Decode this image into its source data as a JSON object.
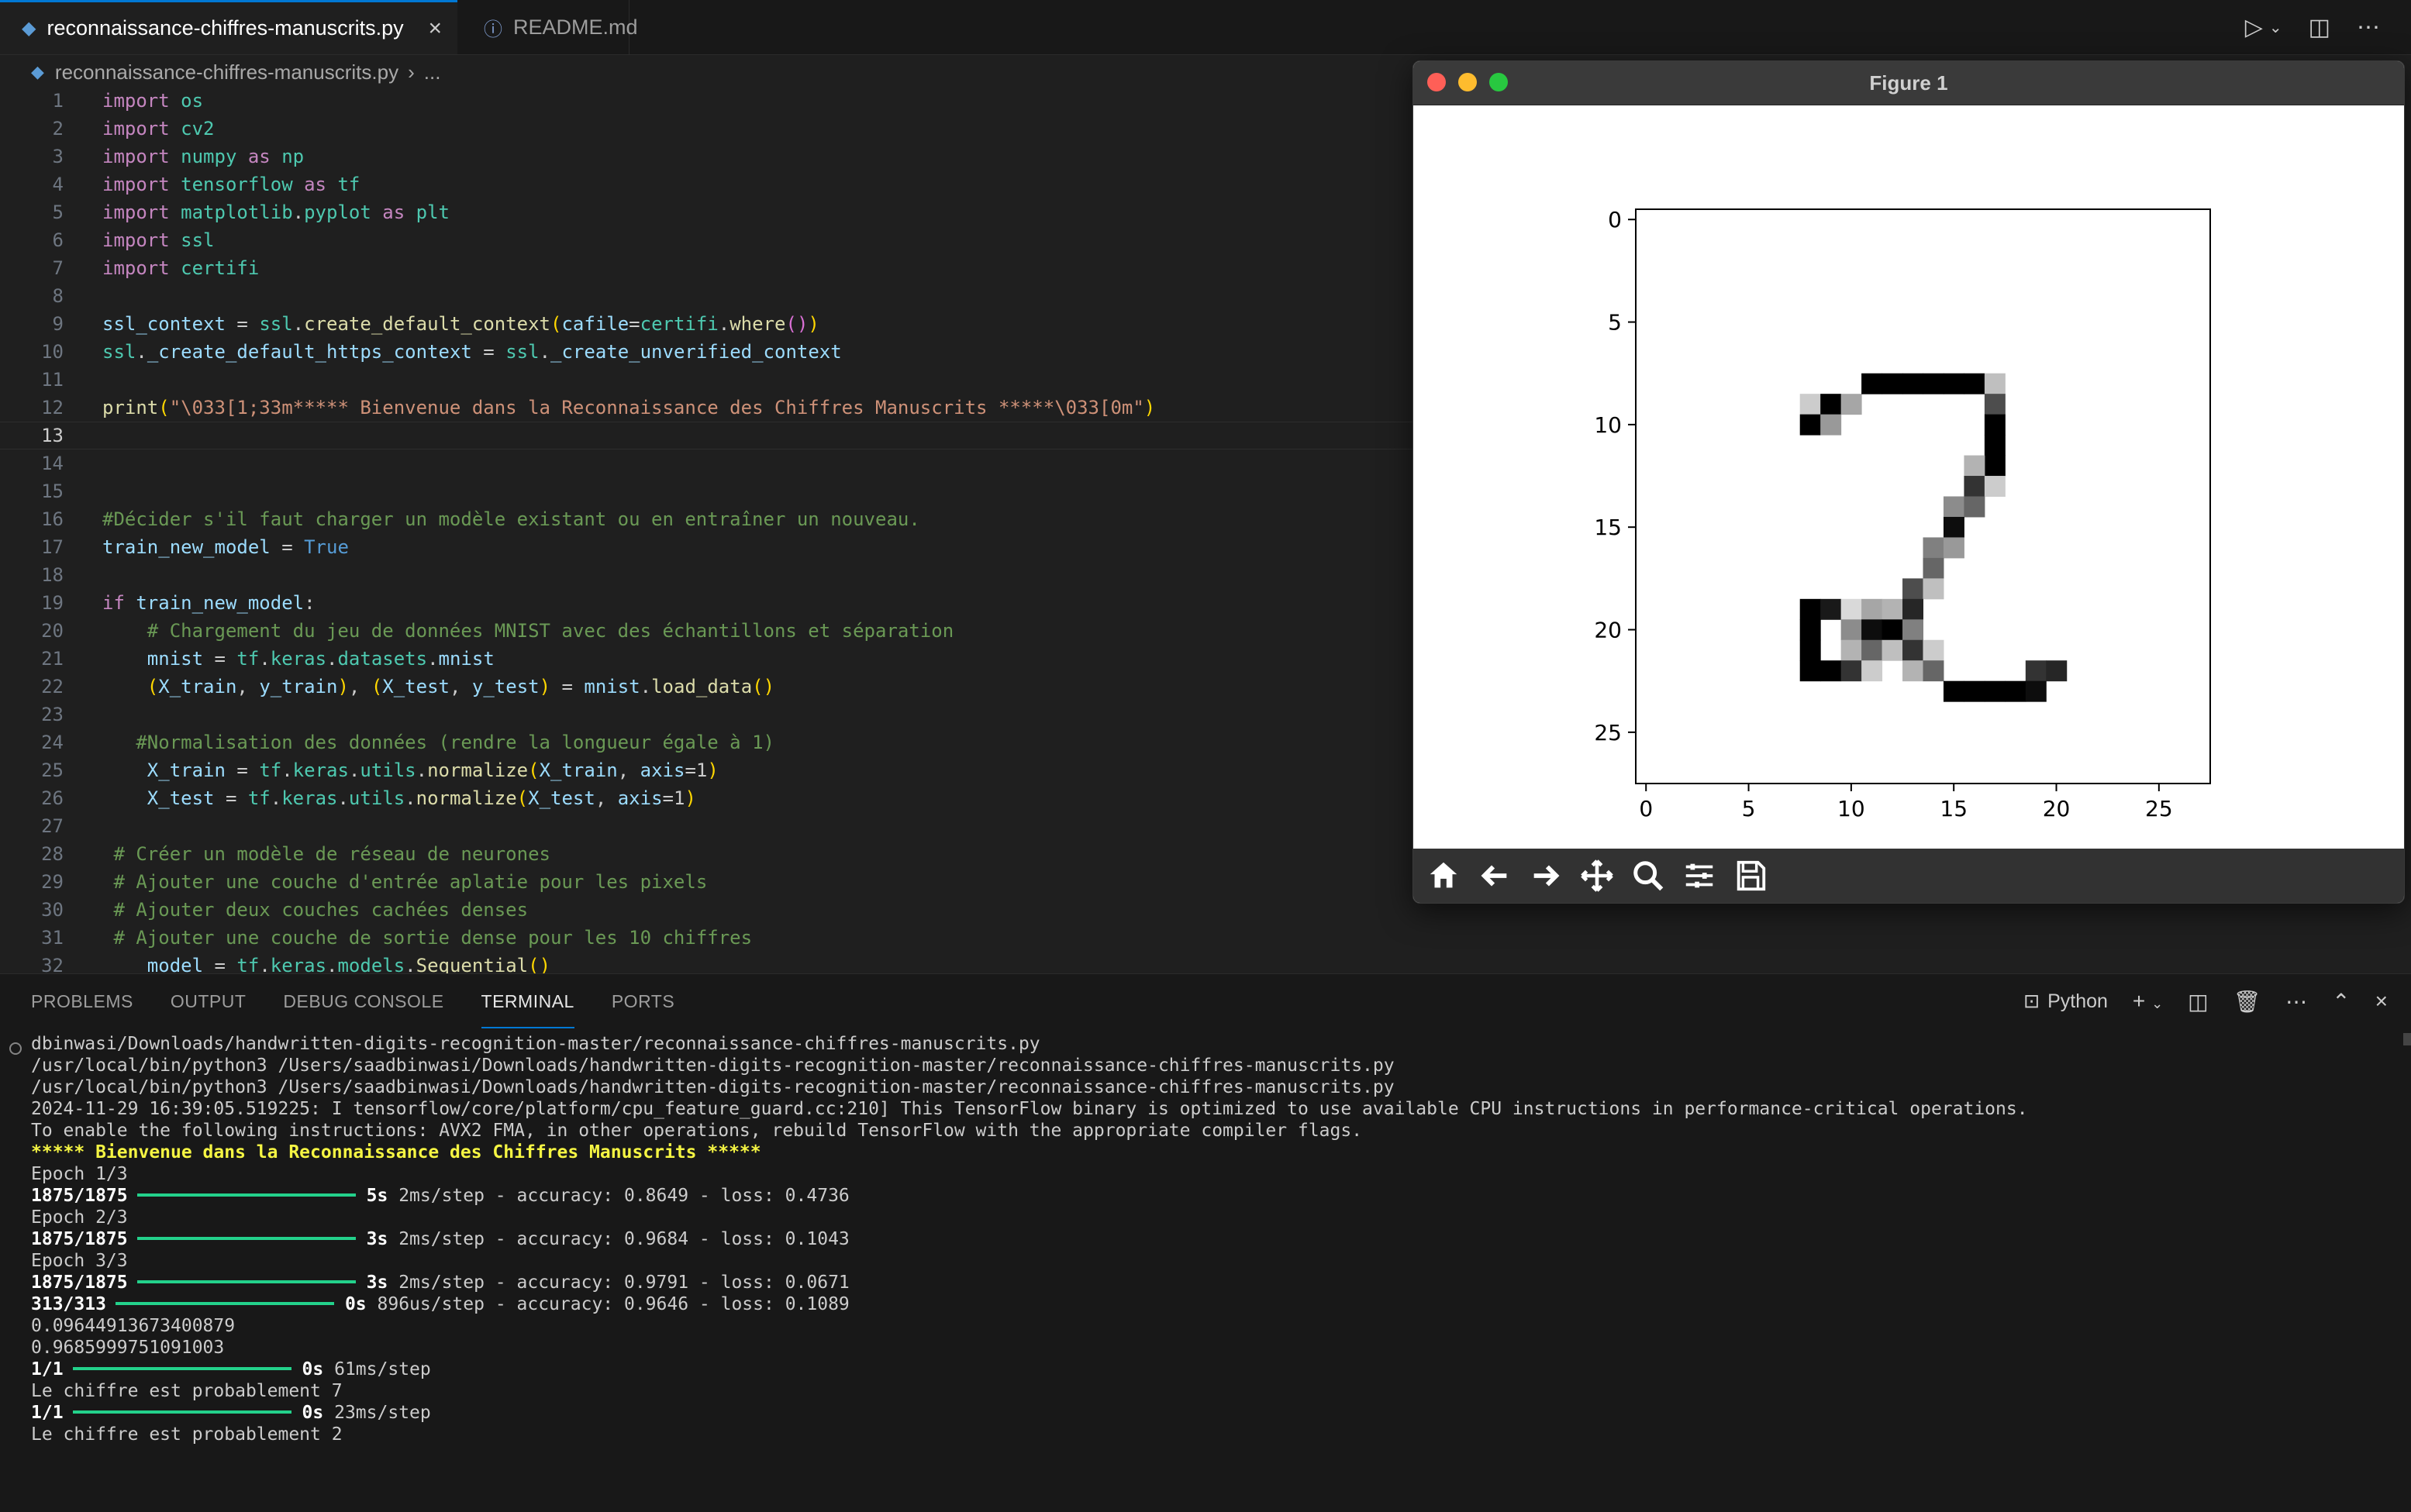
{
  "tabs": [
    {
      "label": "reconnaissance-chiffres-manuscrits.py",
      "icon": "python-file-icon",
      "active": true
    },
    {
      "label": "README.md",
      "icon": "info-icon",
      "active": false
    }
  ],
  "breadcrumb": {
    "file": "reconnaissance-chiffres-manuscrits.py",
    "more": "..."
  },
  "editor": {
    "current_line": 13,
    "lines": [
      {
        "n": "1",
        "text": "import os"
      },
      {
        "n": "2",
        "text": "import cv2"
      },
      {
        "n": "3",
        "text": "import numpy as np"
      },
      {
        "n": "4",
        "text": "import tensorflow as tf"
      },
      {
        "n": "5",
        "text": "import matplotlib.pyplot as plt"
      },
      {
        "n": "6",
        "text": "import ssl"
      },
      {
        "n": "7",
        "text": "import certifi"
      },
      {
        "n": "8",
        "text": ""
      },
      {
        "n": "9",
        "text": "ssl_context = ssl.create_default_context(cafile=certifi.where())"
      },
      {
        "n": "10",
        "text": "ssl._create_default_https_context = ssl._create_unverified_context"
      },
      {
        "n": "11",
        "text": ""
      },
      {
        "n": "12",
        "text": "print(\"\\033[1;33m***** Bienvenue dans la Reconnaissance des Chiffres Manuscrits *****\\033[0m\")"
      },
      {
        "n": "13",
        "text": ""
      },
      {
        "n": "14",
        "text": ""
      },
      {
        "n": "15",
        "text": ""
      },
      {
        "n": "16",
        "text": "#Décider s'il faut charger un modèle existant ou en entraîner un nouveau."
      },
      {
        "n": "17",
        "text": "train_new_model = True"
      },
      {
        "n": "18",
        "text": ""
      },
      {
        "n": "19",
        "text": "if train_new_model:"
      },
      {
        "n": "20",
        "text": "    # Chargement du jeu de données MNIST avec des échantillons et séparation"
      },
      {
        "n": "21",
        "text": "    mnist = tf.keras.datasets.mnist"
      },
      {
        "n": "22",
        "text": "    (X_train, y_train), (X_test, y_test) = mnist.load_data()"
      },
      {
        "n": "23",
        "text": ""
      },
      {
        "n": "24",
        "text": "   #Normalisation des données (rendre la longueur égale à 1)"
      },
      {
        "n": "25",
        "text": "    X_train = tf.keras.utils.normalize(X_train, axis=1)"
      },
      {
        "n": "26",
        "text": "    X_test = tf.keras.utils.normalize(X_test, axis=1)"
      },
      {
        "n": "27",
        "text": ""
      },
      {
        "n": "28",
        "text": " # Créer un modèle de réseau de neurones"
      },
      {
        "n": "29",
        "text": " # Ajouter une couche d'entrée aplatie pour les pixels"
      },
      {
        "n": "30",
        "text": " # Ajouter deux couches cachées denses"
      },
      {
        "n": "31",
        "text": " # Ajouter une couche de sortie dense pour les 10 chiffres"
      },
      {
        "n": "32",
        "text": "    model = tf.keras.models.Sequential()"
      }
    ]
  },
  "figure": {
    "title": "Figure 1",
    "toolbar": [
      "home-icon",
      "back-arrow-icon",
      "forward-arrow-icon",
      "pan-move-icon",
      "zoom-magnifier-icon",
      "configure-subplots-icon",
      "save-icon"
    ]
  },
  "chart_data": {
    "type": "heatmap",
    "title": "",
    "xlabel": "",
    "ylabel": "",
    "xlim": [
      -0.5,
      27.5
    ],
    "ylim": [
      27.5,
      -0.5
    ],
    "xticks": [
      0,
      5,
      10,
      15,
      20,
      25
    ],
    "yticks": [
      0,
      5,
      10,
      15,
      20,
      25
    ],
    "colormap": "binary",
    "cells": [
      [
        8,
        9,
        0.2
      ],
      [
        9,
        9,
        1
      ],
      [
        10,
        9,
        0.35
      ],
      [
        11,
        8,
        1
      ],
      [
        12,
        8,
        1
      ],
      [
        13,
        8,
        1
      ],
      [
        14,
        8,
        1
      ],
      [
        15,
        8,
        1
      ],
      [
        16,
        8,
        1
      ],
      [
        17,
        8,
        0.25
      ],
      [
        8,
        10,
        1
      ],
      [
        9,
        10,
        0.4
      ],
      [
        17,
        9,
        0.7
      ],
      [
        17,
        10,
        1
      ],
      [
        17,
        11,
        1
      ],
      [
        17,
        12,
        1
      ],
      [
        16,
        12,
        0.3
      ],
      [
        16,
        13,
        0.8
      ],
      [
        17,
        13,
        0.2
      ],
      [
        15,
        14,
        0.45
      ],
      [
        16,
        14,
        0.6
      ],
      [
        15,
        15,
        0.95
      ],
      [
        14,
        16,
        0.5
      ],
      [
        15,
        16,
        0.4
      ],
      [
        14,
        17,
        0.6
      ],
      [
        13,
        18,
        0.7
      ],
      [
        14,
        18,
        0.25
      ],
      [
        8,
        19,
        1
      ],
      [
        9,
        19,
        0.9
      ],
      [
        10,
        19,
        0.15
      ],
      [
        11,
        19,
        0.35
      ],
      [
        12,
        19,
        0.3
      ],
      [
        13,
        19,
        0.85
      ],
      [
        8,
        20,
        1
      ],
      [
        10,
        20,
        0.45
      ],
      [
        11,
        20,
        0.95
      ],
      [
        12,
        20,
        1
      ],
      [
        13,
        20,
        0.5
      ],
      [
        8,
        21,
        1
      ],
      [
        10,
        21,
        0.3
      ],
      [
        11,
        21,
        0.6
      ],
      [
        12,
        21,
        0.25
      ],
      [
        13,
        21,
        0.8
      ],
      [
        14,
        21,
        0.2
      ],
      [
        8,
        22,
        1
      ],
      [
        9,
        22,
        1
      ],
      [
        10,
        22,
        0.8
      ],
      [
        11,
        22,
        0.2
      ],
      [
        13,
        22,
        0.3
      ],
      [
        14,
        22,
        0.6
      ],
      [
        19,
        22,
        0.8
      ],
      [
        20,
        22,
        0.85
      ],
      [
        15,
        23,
        1
      ],
      [
        16,
        23,
        1
      ],
      [
        17,
        23,
        1
      ],
      [
        18,
        23,
        1
      ],
      [
        19,
        23,
        0.95
      ]
    ]
  },
  "panel": {
    "tabs": [
      "PROBLEMS",
      "OUTPUT",
      "DEBUG CONSOLE",
      "TERMINAL",
      "PORTS"
    ],
    "active_tab": "TERMINAL",
    "shell_label": "Python"
  },
  "terminal": {
    "l1": "dbinwasi/Downloads/handwritten-digits-recognition-master/reconnaissance-chiffres-manuscrits.py",
    "l2": "/usr/local/bin/python3 /Users/saadbinwasi/Downloads/handwritten-digits-recognition-master/reconnaissance-chiffres-manuscrits.py",
    "l3": "/usr/local/bin/python3 /Users/saadbinwasi/Downloads/handwritten-digits-recognition-master/reconnaissance-chiffres-manuscrits.py",
    "l4": "2024-11-29 16:39:05.519225: I tensorflow/core/platform/cpu_feature_guard.cc:210] This TensorFlow binary is optimized to use available CPU instructions in performance-critical operations.",
    "l5": "To enable the following instructions: AVX2 FMA, in other operations, rebuild TensorFlow with the appropriate compiler flags.",
    "l6": "***** Bienvenue dans la Reconnaissance des Chiffres Manuscrits *****",
    "epoch1": "Epoch 1/3",
    "e1_steps": "1875/1875",
    "e1_time": "5s",
    "e1_rest": "2ms/step - accuracy: 0.8649 - loss: 0.4736",
    "epoch2": "Epoch 2/3",
    "e2_steps": "1875/1875",
    "e2_time": "3s",
    "e2_rest": "2ms/step - accuracy: 0.9684 - loss: 0.1043",
    "epoch3": "Epoch 3/3",
    "e3_steps": "1875/1875",
    "e3_time": "3s",
    "e3_rest": "2ms/step - accuracy: 0.9791 - loss: 0.0671",
    "ev_steps": "313/313",
    "ev_time": "0s",
    "ev_rest": "896us/step - accuracy: 0.9646 - loss: 0.1089",
    "loss_val": "0.09644913673400879",
    "acc_val": "0.9685999751091003",
    "p1_steps": "1/1",
    "p1_time": "0s",
    "p1_rest": "61ms/step",
    "pred1": "Le chiffre est probablement 7",
    "p2_steps": "1/1",
    "p2_time": "0s",
    "p2_rest": "23ms/step",
    "pred2": "Le chiffre est probablement 2"
  }
}
